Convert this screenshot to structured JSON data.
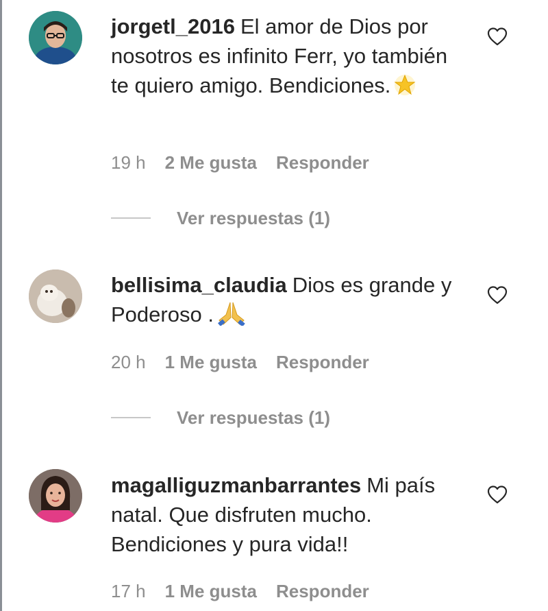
{
  "comments": [
    {
      "username": "jorgetl_2016",
      "text": "El amor de Dios por nosotros es infinito Ferr, yo también te quiero amigo. Bendiciones.",
      "emoji_icon": "glowing-star-icon",
      "time": "19 h",
      "likes": "2 Me gusta",
      "reply": "Responder",
      "view_replies": "Ver respuestas (1)"
    },
    {
      "username": "bellisima_claudia",
      "text": "Dios es grande y Poderoso .",
      "emoji_icon": "folded-hands-icon",
      "time": "20 h",
      "likes": "1 Me gusta",
      "reply": "Responder",
      "view_replies": "Ver respuestas (1)"
    },
    {
      "username": "magalliguzmanbarrantes",
      "text": "Mi país natal. Que disfruten mucho. Bendiciones y pura vida!!",
      "time": "17 h",
      "likes": "1 Me gusta",
      "reply": "Responder"
    }
  ],
  "colors": {
    "text": "#262626",
    "secondary": "#8e8e8e",
    "divider": "#c7c7c7"
  },
  "icons": {
    "like": "heart-outline-icon"
  }
}
